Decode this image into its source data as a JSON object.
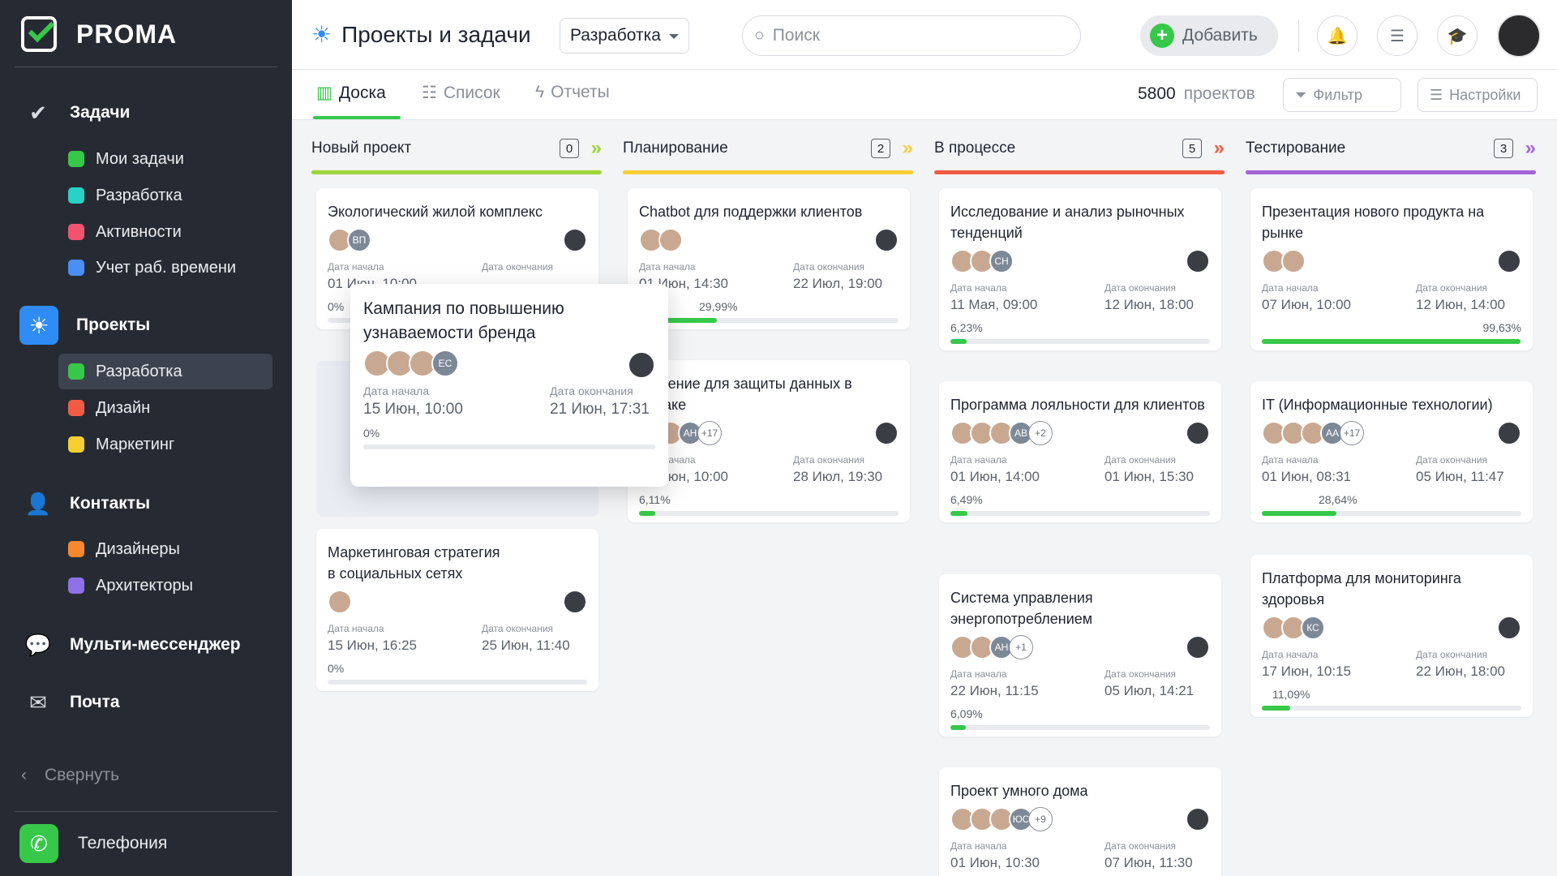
{
  "sidebar": {
    "logo": "PROMA",
    "tasks": {
      "title": "Задачи",
      "items": [
        {
          "label": "Мои задачи",
          "color": "#37c84a"
        },
        {
          "label": "Разработка",
          "color": "#27d3c6"
        },
        {
          "label": "Активности",
          "color": "#f2536e"
        },
        {
          "label": "Учет раб. времени",
          "color": "#4a8ff7"
        }
      ]
    },
    "projects": {
      "title": "Проекты",
      "items": [
        {
          "label": "Разработка",
          "color": "#37c84a"
        },
        {
          "label": "Дизайн",
          "color": "#f35c44"
        },
        {
          "label": "Маркетинг",
          "color": "#f8cf32"
        }
      ]
    },
    "contacts": {
      "title": "Контакты",
      "items": [
        {
          "label": "Дизайнеры",
          "color": "#f7882f"
        },
        {
          "label": "Архитекторы",
          "color": "#8e71e8"
        }
      ]
    },
    "messenger": "Мульти-мессенджер",
    "mail": "Почта",
    "collapse": "Свернуть",
    "telephony": "Телефония"
  },
  "header": {
    "title": "Проекты и задачи",
    "project_select": "Разработка",
    "search_placeholder": "Поиск",
    "add_label": "Добавить"
  },
  "toolbar": {
    "tabs": [
      "Доска",
      "Список",
      "Отчеты"
    ],
    "project_count": "5800",
    "project_count_label": "проектов",
    "filter_label": "Фильтр",
    "settings_label": "Настройки"
  },
  "labels": {
    "start": "Дата начала",
    "end": "Дата окончания"
  },
  "columns": [
    {
      "title": "Новый проект",
      "count": "0",
      "color": "#9dd53a",
      "cards": [
        {
          "title": "Экологический жилой комплекс",
          "avatars": [
            "p",
            "ВП"
          ],
          "start": "01 Июн, 10:00",
          "end": "",
          "progress": "0%",
          "fill": 0
        },
        {
          "title": "Маркетинговая стратегия\nв социальных сетях",
          "avatars": [
            "p"
          ],
          "start": "15 Июн, 16:25",
          "end": "25 Июн, 11:40",
          "progress": "0%",
          "fill": 0
        }
      ]
    },
    {
      "title": "Планирование",
      "count": "2",
      "color": "#f8cf32",
      "cards": [
        {
          "title": "Chatbot для поддержки клиентов",
          "avatars": [
            "p",
            "p"
          ],
          "start": "01 Июн, 14:30",
          "end": "22 Июл, 19:00",
          "progress": "29,99%",
          "fill": 0.2999
        },
        {
          "title": "Решение для защиты данных в облаке",
          "avatars": [
            "p",
            "p",
            "АН",
            "+17"
          ],
          "start": "27 Июн, 10:00",
          "end": "28 Июл, 19:30",
          "progress": "6,11%",
          "fill": 0.0611
        }
      ]
    },
    {
      "title": "В процессе",
      "count": "5",
      "color": "#f35c44",
      "cards": [
        {
          "title": "Исследование и анализ рыночных тенденций",
          "avatars": [
            "p",
            "p",
            "СН"
          ],
          "start": "11 Мая, 09:00",
          "end": "12 Июн, 18:00",
          "progress": "6,23%",
          "fill": 0.0623
        },
        {
          "title": "Программа лояльности для клиентов",
          "avatars": [
            "p",
            "p",
            "p",
            "АВ",
            "+2"
          ],
          "start": "01 Июн, 14:00",
          "end": "01 Июн, 15:30",
          "progress": "6,49%",
          "fill": 0.0649
        },
        {
          "title": "Система управления энергопотреблением",
          "avatars": [
            "p",
            "p",
            "АН",
            "+1"
          ],
          "start": "22 Июн, 11:15",
          "end": "05 Июл, 14:21",
          "progress": "6,09%",
          "fill": 0.0609
        },
        {
          "title": "Проект умного дома",
          "avatars": [
            "p",
            "p",
            "p",
            "ЮС",
            "+9"
          ],
          "start": "01 Июн, 10:30",
          "end": "07 Июн, 11:30",
          "progress": "",
          "fill": 0
        }
      ]
    },
    {
      "title": "Тестирование",
      "count": "3",
      "color": "#a462d8",
      "cards": [
        {
          "title": "Презентация нового продукта на рынке",
          "avatars": [
            "p",
            "p"
          ],
          "start": "07 Июн, 10:00",
          "end": "12 Июн, 14:00",
          "progress": "99,63%",
          "fill": 0.9963
        },
        {
          "title": "IT (Информационные технологии)",
          "avatars": [
            "p",
            "p",
            "p",
            "АА",
            "+17"
          ],
          "start": "01 Июн, 08:31",
          "end": "05 Июн, 11:47",
          "progress": "28,64%",
          "fill": 0.2864
        },
        {
          "title": "Платформа для мониторинга здоровья",
          "avatars": [
            "p",
            "p",
            "КС"
          ],
          "start": "17 Июн, 10:15",
          "end": "22 Июн, 18:00",
          "progress": "11,09%",
          "fill": 0.1109
        }
      ]
    }
  ],
  "dragging_card": {
    "title": "Кампания по повышению узнаваемости бренда",
    "avatars": [
      "p",
      "p",
      "p",
      "ЕС"
    ],
    "start": "15 Июн, 10:00",
    "end": "21 Июн, 17:31",
    "progress": "0%",
    "fill": 0
  }
}
